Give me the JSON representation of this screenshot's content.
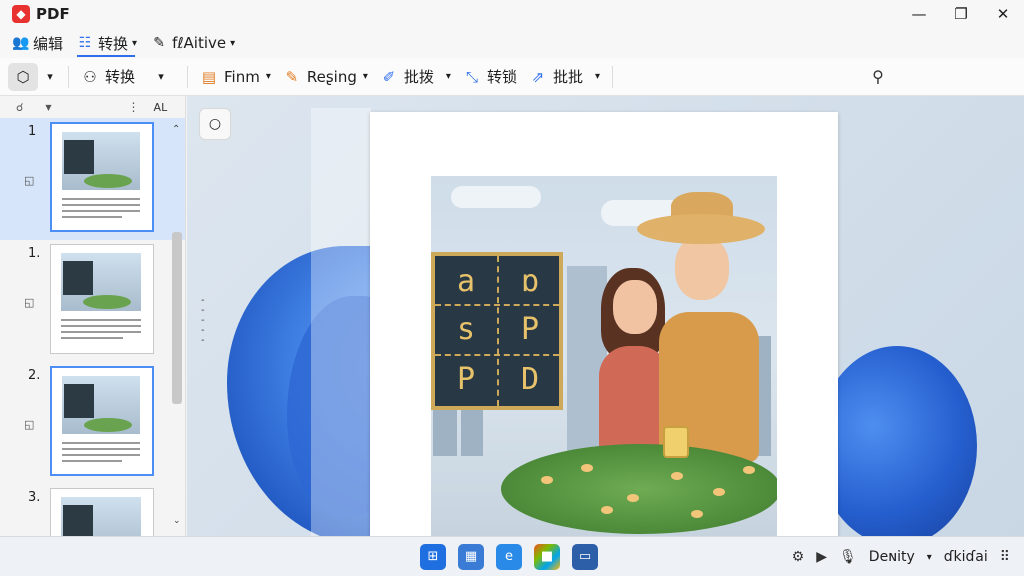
{
  "app": {
    "title": "PDF"
  },
  "window": {
    "minimize": "—",
    "restore": "❐",
    "close": "✕"
  },
  "menu": {
    "items": [
      {
        "label": "编辑",
        "icon": "people-icon",
        "glyph": "👥",
        "has_caret": false,
        "active": false
      },
      {
        "label": "转换",
        "icon": "grid-icon",
        "glyph": "☷",
        "has_caret": true,
        "active": true
      },
      {
        "label": "fℓAitive",
        "icon": "edit-doc-icon",
        "glyph": "✎",
        "has_caret": true,
        "active": false
      }
    ]
  },
  "toolbar": {
    "select_glyph": "⬡",
    "convert_label": "转换",
    "form_label": "Finm",
    "resign_label": "Reʂing",
    "batch_label": "批拨",
    "convert2_label": "转锁",
    "batch2_label": "批批",
    "caret": "▾"
  },
  "sidebar": {
    "header_more": "⋮",
    "header_al": "AL",
    "thumbs": [
      {
        "number": "1",
        "selected": true
      },
      {
        "number": "1.",
        "selected": false
      },
      {
        "number": "2.",
        "selected": false,
        "active_border": true
      },
      {
        "number": "3.",
        "selected": false
      }
    ]
  },
  "canvas": {
    "circle_tool_glyph": "○",
    "sign_letters": [
      "a",
      "ɒ",
      "s",
      "P",
      "P",
      "D"
    ]
  },
  "taskbar": {
    "right": {
      "density_label": "Deɴity",
      "extra_label": "ɗkiɗai"
    }
  }
}
